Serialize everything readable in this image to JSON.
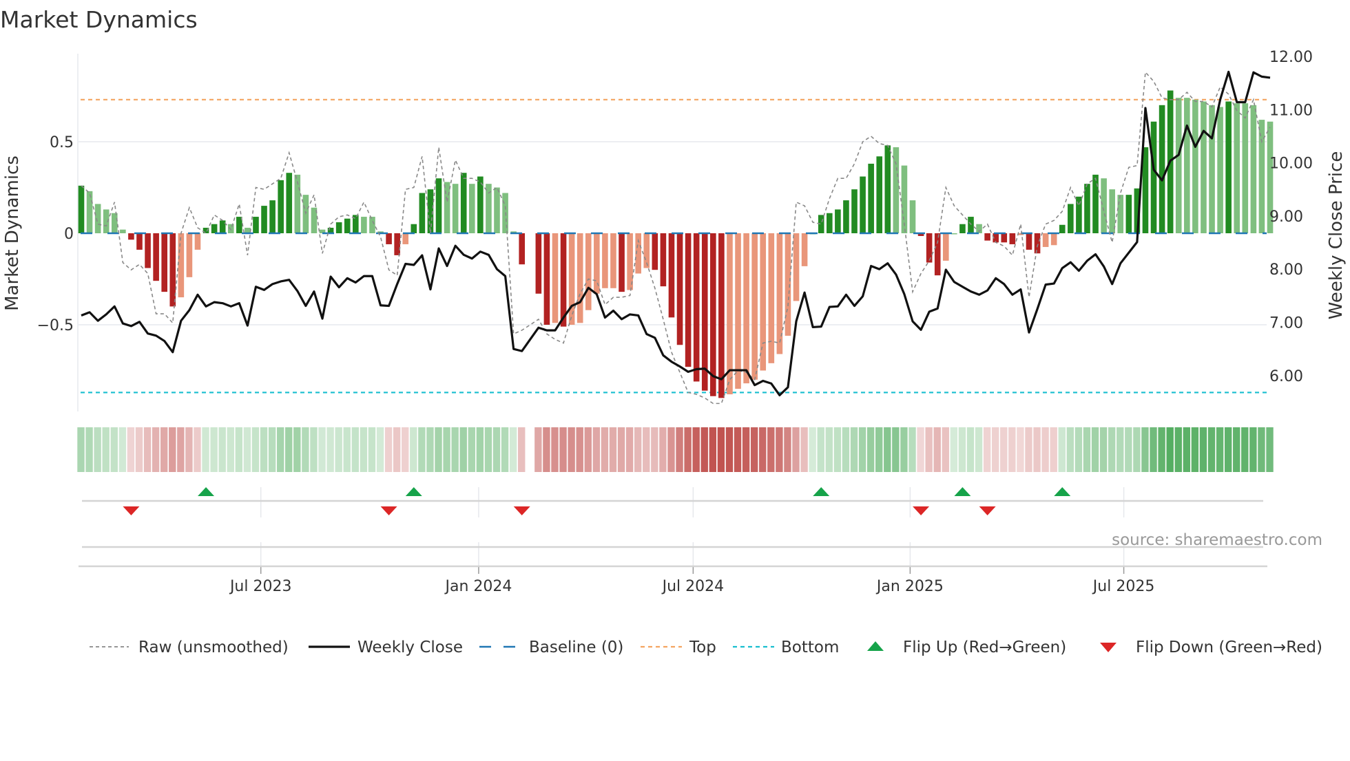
{
  "chart_data": {
    "type": "bar",
    "title": "Market Dynamics",
    "ylabel_left": "Market Dynamics",
    "ylabel_right": "Weekly Close Price",
    "ylim_left": [
      -0.93,
      0.98
    ],
    "ylim_right": [
      5.35,
      12.1
    ],
    "left_ticks": [
      {
        "v": 0.5,
        "label": "0.5"
      },
      {
        "v": 0,
        "label": "0"
      },
      {
        "v": -0.5,
        "label": "−0.5"
      }
    ],
    "right_ticks": [
      {
        "v": 12,
        "label": "12.00"
      },
      {
        "v": 11,
        "label": "11.00"
      },
      {
        "v": 10,
        "label": "10.00"
      },
      {
        "v": 9,
        "label": "9.00"
      },
      {
        "v": 8,
        "label": "8.00"
      },
      {
        "v": 7,
        "label": "7.00"
      },
      {
        "v": 6,
        "label": "6.00"
      }
    ],
    "x_ticks": [
      {
        "week": 21.6,
        "label": "Jul 2023"
      },
      {
        "week": 47.8,
        "label": "Jan 2024"
      },
      {
        "week": 73.6,
        "label": "Jul 2024"
      },
      {
        "week": 99.7,
        "label": "Jan 2025"
      },
      {
        "week": 125.4,
        "label": "Jul 2025"
      }
    ],
    "top_level": 0.73,
    "bottom_level": -0.87,
    "baseline": 0,
    "dynamics": [
      0.26,
      0.23,
      0.16,
      0.13,
      0.11,
      0.02,
      -0.035,
      -0.09,
      -0.19,
      -0.26,
      -0.32,
      -0.4,
      -0.35,
      -0.24,
      -0.09,
      0.03,
      0.05,
      0.07,
      0.05,
      0.09,
      0.03,
      0.09,
      0.15,
      0.18,
      0.29,
      0.33,
      0.32,
      0.21,
      0.14,
      0.02,
      0.03,
      0.06,
      0.08,
      0.1,
      0.09,
      0.09,
      0.01,
      -0.06,
      -0.12,
      -0.06,
      0.05,
      0.22,
      0.24,
      0.3,
      0.28,
      0.27,
      0.33,
      0.27,
      0.31,
      0.27,
      0.25,
      0.22,
      0.01,
      -0.17,
      null,
      -0.33,
      -0.5,
      -0.49,
      -0.51,
      -0.5,
      -0.49,
      -0.42,
      -0.33,
      -0.3,
      -0.3,
      -0.32,
      -0.31,
      -0.22,
      -0.19,
      -0.2,
      -0.29,
      -0.46,
      -0.61,
      -0.73,
      -0.81,
      -0.86,
      -0.89,
      -0.9,
      -0.88,
      -0.85,
      -0.82,
      -0.8,
      -0.75,
      -0.71,
      -0.66,
      -0.56,
      -0.37,
      -0.18,
      0.0,
      0.1,
      0.11,
      0.13,
      0.18,
      0.24,
      0.31,
      0.38,
      0.42,
      0.48,
      0.47,
      0.37,
      0.18,
      -0.015,
      -0.16,
      -0.23,
      -0.15,
      0.0,
      0.05,
      0.09,
      0.05,
      -0.04,
      -0.05,
      -0.05,
      -0.06,
      -0.01,
      -0.09,
      -0.11,
      -0.075,
      -0.065,
      0.046,
      0.16,
      0.2,
      0.27,
      0.32,
      0.3,
      0.24,
      0.21,
      0.21,
      0.245,
      0.47,
      0.61,
      0.7,
      0.78,
      0.74,
      0.74,
      0.73,
      0.72,
      0.7,
      0.69,
      0.72,
      0.71,
      0.71,
      0.7,
      0.62,
      0.61
    ],
    "strong": "DLLLLLDDDDDDLLLDDDLDLDDDDDLLLLDDDDLLLDDLDDDDLLDLDLLLLD-DDLDLLLLLLDLLLDDDDDDDDDLLLLLLLLLLLDDDDDDDDDLLLDDDLLDDLDDDDLDDLLDDDDDLLLDDDDDDLLLLLLDLLLLL",
    "raw": [
      0.26,
      0.22,
      0.05,
      0.04,
      0.17,
      -0.16,
      -0.2,
      -0.17,
      -0.22,
      -0.44,
      -0.44,
      -0.49,
      0.0,
      0.14,
      0.03,
      0.0,
      0.1,
      0.07,
      0.02,
      0.16,
      -0.12,
      0.25,
      0.24,
      0.27,
      0.3,
      0.44,
      0.28,
      0.11,
      0.21,
      -0.11,
      0.05,
      0.09,
      0.1,
      0.08,
      0.17,
      0.07,
      -0.02,
      -0.2,
      -0.23,
      0.24,
      0.25,
      0.42,
      0.0,
      0.47,
      0.17,
      0.4,
      0.3,
      0.3,
      0.28,
      0.22,
      0.25,
      0.15,
      -0.55,
      -0.53,
      -0.5,
      -0.47,
      -0.55,
      -0.58,
      -0.6,
      -0.45,
      -0.33,
      -0.25,
      -0.26,
      -0.39,
      -0.35,
      -0.35,
      -0.34,
      -0.04,
      -0.16,
      -0.3,
      -0.47,
      -0.65,
      -0.76,
      -0.87,
      -0.88,
      -0.9,
      -0.93,
      -0.93,
      -0.8,
      -0.75,
      -0.76,
      -0.8,
      -0.6,
      -0.59,
      -0.6,
      -0.4,
      0.17,
      0.15,
      0.06,
      0.05,
      0.19,
      0.3,
      0.3,
      0.38,
      0.5,
      0.53,
      0.49,
      0.48,
      0.38,
      0.05,
      -0.32,
      -0.22,
      -0.15,
      -0.05,
      0.25,
      0.15,
      0.1,
      0.05,
      0.01,
      0.05,
      -0.05,
      -0.07,
      -0.12,
      0.05,
      -0.35,
      -0.07,
      0.05,
      0.07,
      0.12,
      0.25,
      0.15,
      0.27,
      0.3,
      0.12,
      -0.05,
      0.22,
      0.36,
      0.37,
      0.88,
      0.83,
      0.74,
      0.73,
      0.73,
      0.77,
      0.72,
      0.72,
      0.69,
      0.8,
      0.76,
      0.67,
      0.63,
      0.73,
      0.5,
      0.58
    ],
    "close": [
      7.13,
      7.19,
      7.03,
      7.15,
      7.3,
      6.98,
      6.93,
      7.01,
      6.79,
      6.75,
      6.65,
      6.44,
      7.03,
      7.23,
      7.52,
      7.3,
      7.38,
      7.36,
      7.3,
      7.36,
      6.94,
      7.67,
      7.61,
      7.72,
      7.77,
      7.8,
      7.59,
      7.31,
      7.58,
      7.07,
      7.86,
      7.66,
      7.83,
      7.75,
      7.87,
      7.87,
      7.32,
      7.31,
      7.72,
      8.1,
      8.08,
      8.26,
      7.62,
      8.39,
      8.06,
      8.44,
      8.27,
      8.2,
      8.33,
      8.27,
      8.0,
      7.87,
      6.5,
      6.46,
      6.68,
      6.9,
      6.85,
      6.85,
      7.09,
      7.31,
      7.38,
      7.65,
      7.53,
      7.09,
      7.22,
      7.06,
      7.15,
      7.13,
      6.78,
      6.71,
      6.38,
      6.26,
      6.17,
      6.07,
      6.12,
      6.13,
      5.99,
      5.93,
      6.1,
      6.1,
      6.1,
      5.82,
      5.9,
      5.85,
      5.63,
      5.78,
      7.02,
      7.56,
      6.91,
      6.92,
      7.29,
      7.3,
      7.52,
      7.31,
      7.49,
      8.06,
      8.0,
      8.11,
      7.9,
      7.53,
      7.02,
      6.86,
      7.2,
      7.26,
      7.99,
      7.76,
      7.67,
      7.58,
      7.52,
      7.6,
      7.83,
      7.72,
      7.52,
      7.62,
      6.81,
      7.25,
      7.71,
      7.73,
      8.02,
      8.13,
      7.97,
      8.16,
      8.28,
      8.05,
      7.72,
      8.11,
      8.31,
      8.51,
      11.03,
      9.87,
      9.67,
      10.04,
      10.15,
      10.7,
      10.3,
      10.6,
      10.46,
      11.19,
      11.71,
      11.14,
      11.14,
      11.7,
      11.62,
      11.6
    ],
    "flip_up_weeks": [
      15,
      40,
      89,
      106,
      118
    ],
    "flip_down_weeks": [
      6,
      37,
      53,
      101,
      109
    ],
    "legend": [
      {
        "key": "raw",
        "label": "Raw (unsmoothed)"
      },
      {
        "key": "close",
        "label": "Weekly Close"
      },
      {
        "key": "baseline",
        "label": "Baseline (0)"
      },
      {
        "key": "top",
        "label": "Top"
      },
      {
        "key": "bottom",
        "label": "Bottom"
      },
      {
        "key": "up",
        "label": "Flip Up (Red→Green)"
      },
      {
        "key": "down",
        "label": "Flip Down (Green→Red)"
      }
    ],
    "legend_placement": "bottom",
    "source": "source: sharemaestro.com"
  },
  "colors": {
    "strong_green": "#228b22",
    "light_green": "#7fbf7f",
    "strong_red": "#b22222",
    "light_red": "#e9967a",
    "baseline": "#1f77b4",
    "top": "#f4a460",
    "bottom": "#17becf",
    "raw": "#888888",
    "close": "#111111",
    "flip_up": "#16a34a",
    "flip_down": "#dc2626"
  }
}
